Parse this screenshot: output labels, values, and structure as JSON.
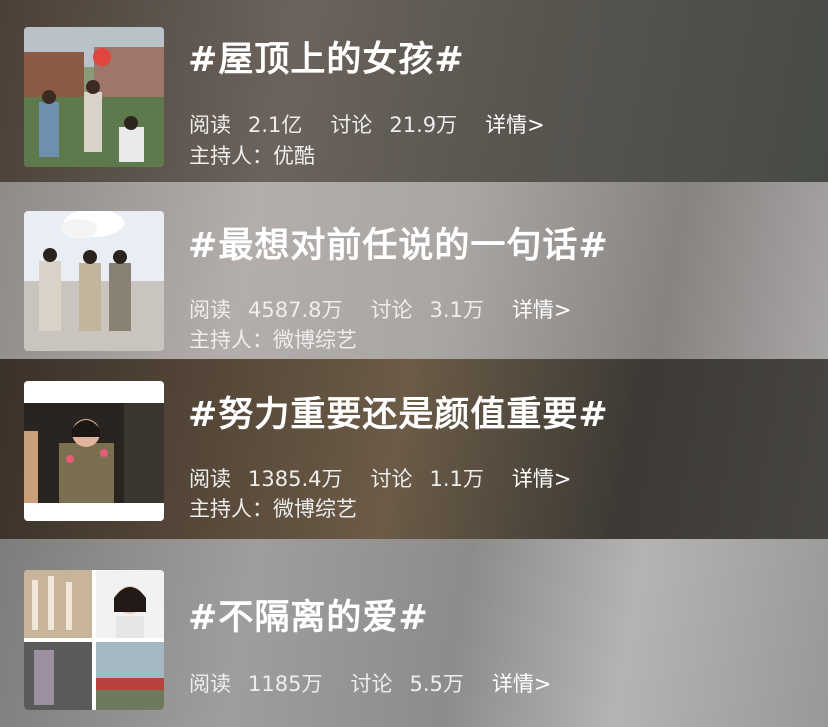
{
  "topics": [
    {
      "title": "#屋顶上的女孩#",
      "read_label": "阅读",
      "read_value": "2.1亿",
      "discuss_label": "讨论",
      "discuss_value": "21.9万",
      "detail_label": "详情>",
      "host_label": "主持人：",
      "host_value": "优酷"
    },
    {
      "title": "#最想对前任说的一句话#",
      "read_label": "阅读",
      "read_value": "4587.8万",
      "discuss_label": "讨论",
      "discuss_value": "3.1万",
      "detail_label": "详情>",
      "host_label": "主持人：",
      "host_value": "微博综艺"
    },
    {
      "title": "#努力重要还是颜值重要#",
      "read_label": "阅读",
      "read_value": "1385.4万",
      "discuss_label": "讨论",
      "discuss_value": "1.1万",
      "detail_label": "详情>",
      "host_label": "主持人：",
      "host_value": "微博综艺"
    },
    {
      "title": "#不隔离的爱#",
      "read_label": "阅读",
      "read_value": "1185万",
      "discuss_label": "讨论",
      "discuss_value": "5.5万",
      "detail_label": "详情>"
    }
  ],
  "colors": {
    "text": "#ffffff",
    "subtext": "#eeeeee"
  }
}
